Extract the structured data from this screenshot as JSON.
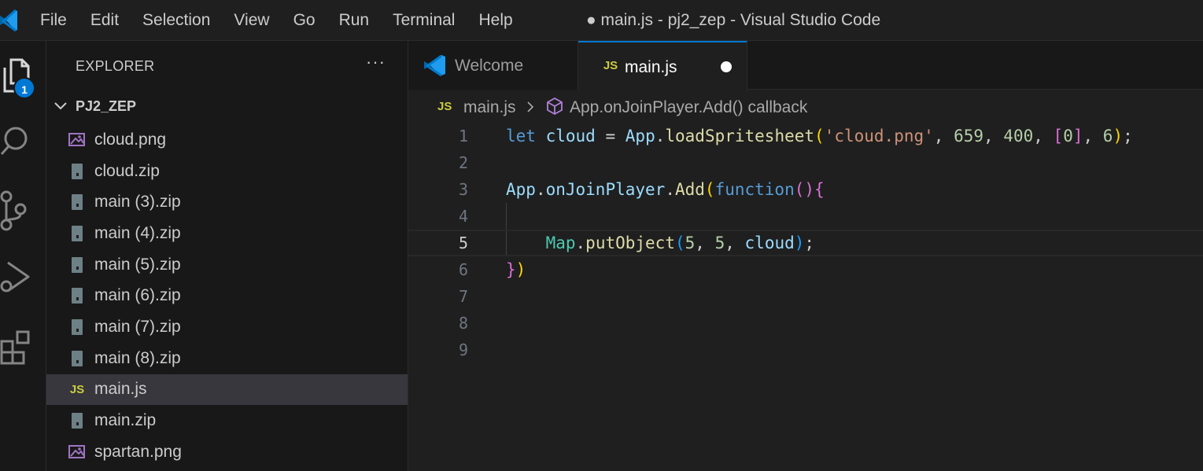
{
  "window": {
    "title": "● main.js - pj2_zep - Visual Studio Code"
  },
  "menu": [
    "File",
    "Edit",
    "Selection",
    "View",
    "Go",
    "Run",
    "Terminal",
    "Help"
  ],
  "activity_bar": {
    "items": [
      "explorer-icon",
      "search-icon",
      "source-control-icon",
      "run-debug-icon",
      "extensions-icon"
    ],
    "explorer_badge": "1"
  },
  "explorer": {
    "title": "EXPLORER",
    "more": "···",
    "folder": "PJ2_ZEP",
    "files": [
      {
        "name": "cloud.png",
        "icon": "image-file-icon"
      },
      {
        "name": "cloud.zip",
        "icon": "zip-file-icon"
      },
      {
        "name": "main (3).zip",
        "icon": "zip-file-icon"
      },
      {
        "name": "main (4).zip",
        "icon": "zip-file-icon"
      },
      {
        "name": "main (5).zip",
        "icon": "zip-file-icon"
      },
      {
        "name": "main (6).zip",
        "icon": "zip-file-icon"
      },
      {
        "name": "main (7).zip",
        "icon": "zip-file-icon"
      },
      {
        "name": "main (8).zip",
        "icon": "zip-file-icon"
      },
      {
        "name": "main.js",
        "icon": "js-file-icon",
        "selected": true
      },
      {
        "name": "main.zip",
        "icon": "zip-file-icon"
      },
      {
        "name": "spartan.png",
        "icon": "image-file-icon"
      }
    ]
  },
  "tabs": [
    {
      "label": "Welcome",
      "icon": "vscode-logo-icon",
      "active": false
    },
    {
      "label": "main.js",
      "icon": "js-file-icon",
      "active": true,
      "unsaved": true
    }
  ],
  "breadcrumb": {
    "file": "main.js",
    "symbol": "App.onJoinPlayer.Add() callback"
  },
  "editor": {
    "current_line": 5,
    "lines": [
      {
        "no": "1",
        "text": "let cloud = App.loadSpritesheet('cloud.png', 659, 400, [0], 6);"
      },
      {
        "no": "2",
        "text": ""
      },
      {
        "no": "3",
        "text": "App.onJoinPlayer.Add(function(){"
      },
      {
        "no": "4",
        "text": ""
      },
      {
        "no": "5",
        "text": "    Map.putObject(5, 5, cloud);"
      },
      {
        "no": "6",
        "text": "})"
      },
      {
        "no": "7",
        "text": ""
      },
      {
        "no": "8",
        "text": ""
      },
      {
        "no": "9",
        "text": ""
      }
    ]
  },
  "colors": {
    "accent": "#0078d4",
    "js_icon": "#cbcb41",
    "image_icon": "#a074c4"
  }
}
